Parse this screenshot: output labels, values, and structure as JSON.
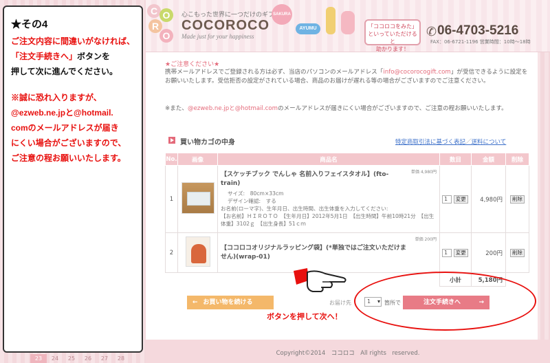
{
  "panel": {
    "title": "★その4",
    "lines": [
      "ご注文内容に間違いがなければ、",
      "「注文手続きへ」",
      "ボタンを",
      "押して次に進んでください。",
      "※誠に恐れ入りますが、",
      "@ezweb.ne.jpと@hotmail.",
      "comのメールアドレスが届き",
      "にくい場合がございますので、",
      "ご注意の程お願いいたします。"
    ]
  },
  "header": {
    "tagline": "心こもった世界に一つだけのギフト",
    "brand": "COCOROCO",
    "brand_sub": "Made just for your happiness",
    "logo_letters": [
      "C",
      "O",
      "R",
      "O"
    ],
    "badges": [
      "SAKURA",
      "AYUMU"
    ],
    "speech": [
      "「ココロコをみた」",
      "といっていただけると",
      "助かります！"
    ],
    "phone": "06-4703-5216",
    "fax": "FAX：06-6721-1196  営業時間：10時～18時"
  },
  "notice": {
    "head": "★ご注意ください★",
    "p1_a": "携帯メールアドレスでご登録される方は必ず、当店のパソコンのメールアドレス「",
    "p1_mail": "info@cocorocogift.com",
    "p1_b": "」が受信できるように設定をお願いいたします。受信拒否の設定がされている場合、商品のお届けが遅れる等の場合がございますのでご注意ください。",
    "p2_a": "※また、",
    "p2_domains": "@ezweb.ne.jpと@hotmail.com",
    "p2_b": "のメールアドレスが届きにくい場合がございますので、ご注意の程お願いいたします。"
  },
  "cart": {
    "title": "買い物カゴの中身",
    "link1": "特定商取引法に基づく表記",
    "link_sep": "／",
    "link2": "送料について",
    "headers": [
      "No.",
      "画像",
      "商品名",
      "数目",
      "金額",
      "削除"
    ],
    "items": [
      {
        "no": "1",
        "name": "【スケッチブック でんしゃ 名前入りフェイスタオル】(fto-train)",
        "unit_price": "単価 4,980円",
        "options": [
          "サイズ:　80cm×33cm",
          "デザイン確認:　する",
          "お名前(ローマ字)、生年月日、出生時間、出生体重を入力してください:",
          "【お名前】ＨＩＲＯＴＯ　【生年月日】2012年5月1日　【出生時間】午前10時21分　【出生体重】3102ｇ　【出生身長】51ｃｍ"
        ],
        "qty": "1",
        "change": "変更",
        "price": "4,980円",
        "delete": "削除"
      },
      {
        "no": "2",
        "name": "【ココロコオリジナルラッピング袋】(*単独ではご注文いただけません)(wrap-01)",
        "unit_price": "単価 200円",
        "options": [],
        "qty": "1",
        "change": "変更",
        "price": "200円",
        "delete": "削除"
      }
    ],
    "subtotal_label": "小計",
    "subtotal": "5,180円"
  },
  "actions": {
    "continue_label": "お買い物を続ける",
    "ship_label": "お届け先",
    "ship_count": "1",
    "ship_unit": "箇所で",
    "checkout_label": "注文手続きへ"
  },
  "annotation": "ボタンを押して次へ！",
  "footer": "Copyright©2014　ココロコ　All rights　reserved.",
  "calendar": [
    "23",
    "24",
    "25",
    "26",
    "27",
    "28"
  ],
  "colors": {
    "accent_pink": "#e87b86",
    "annotation_red": "#e8100e",
    "continue_orange": "#f4b86a"
  }
}
